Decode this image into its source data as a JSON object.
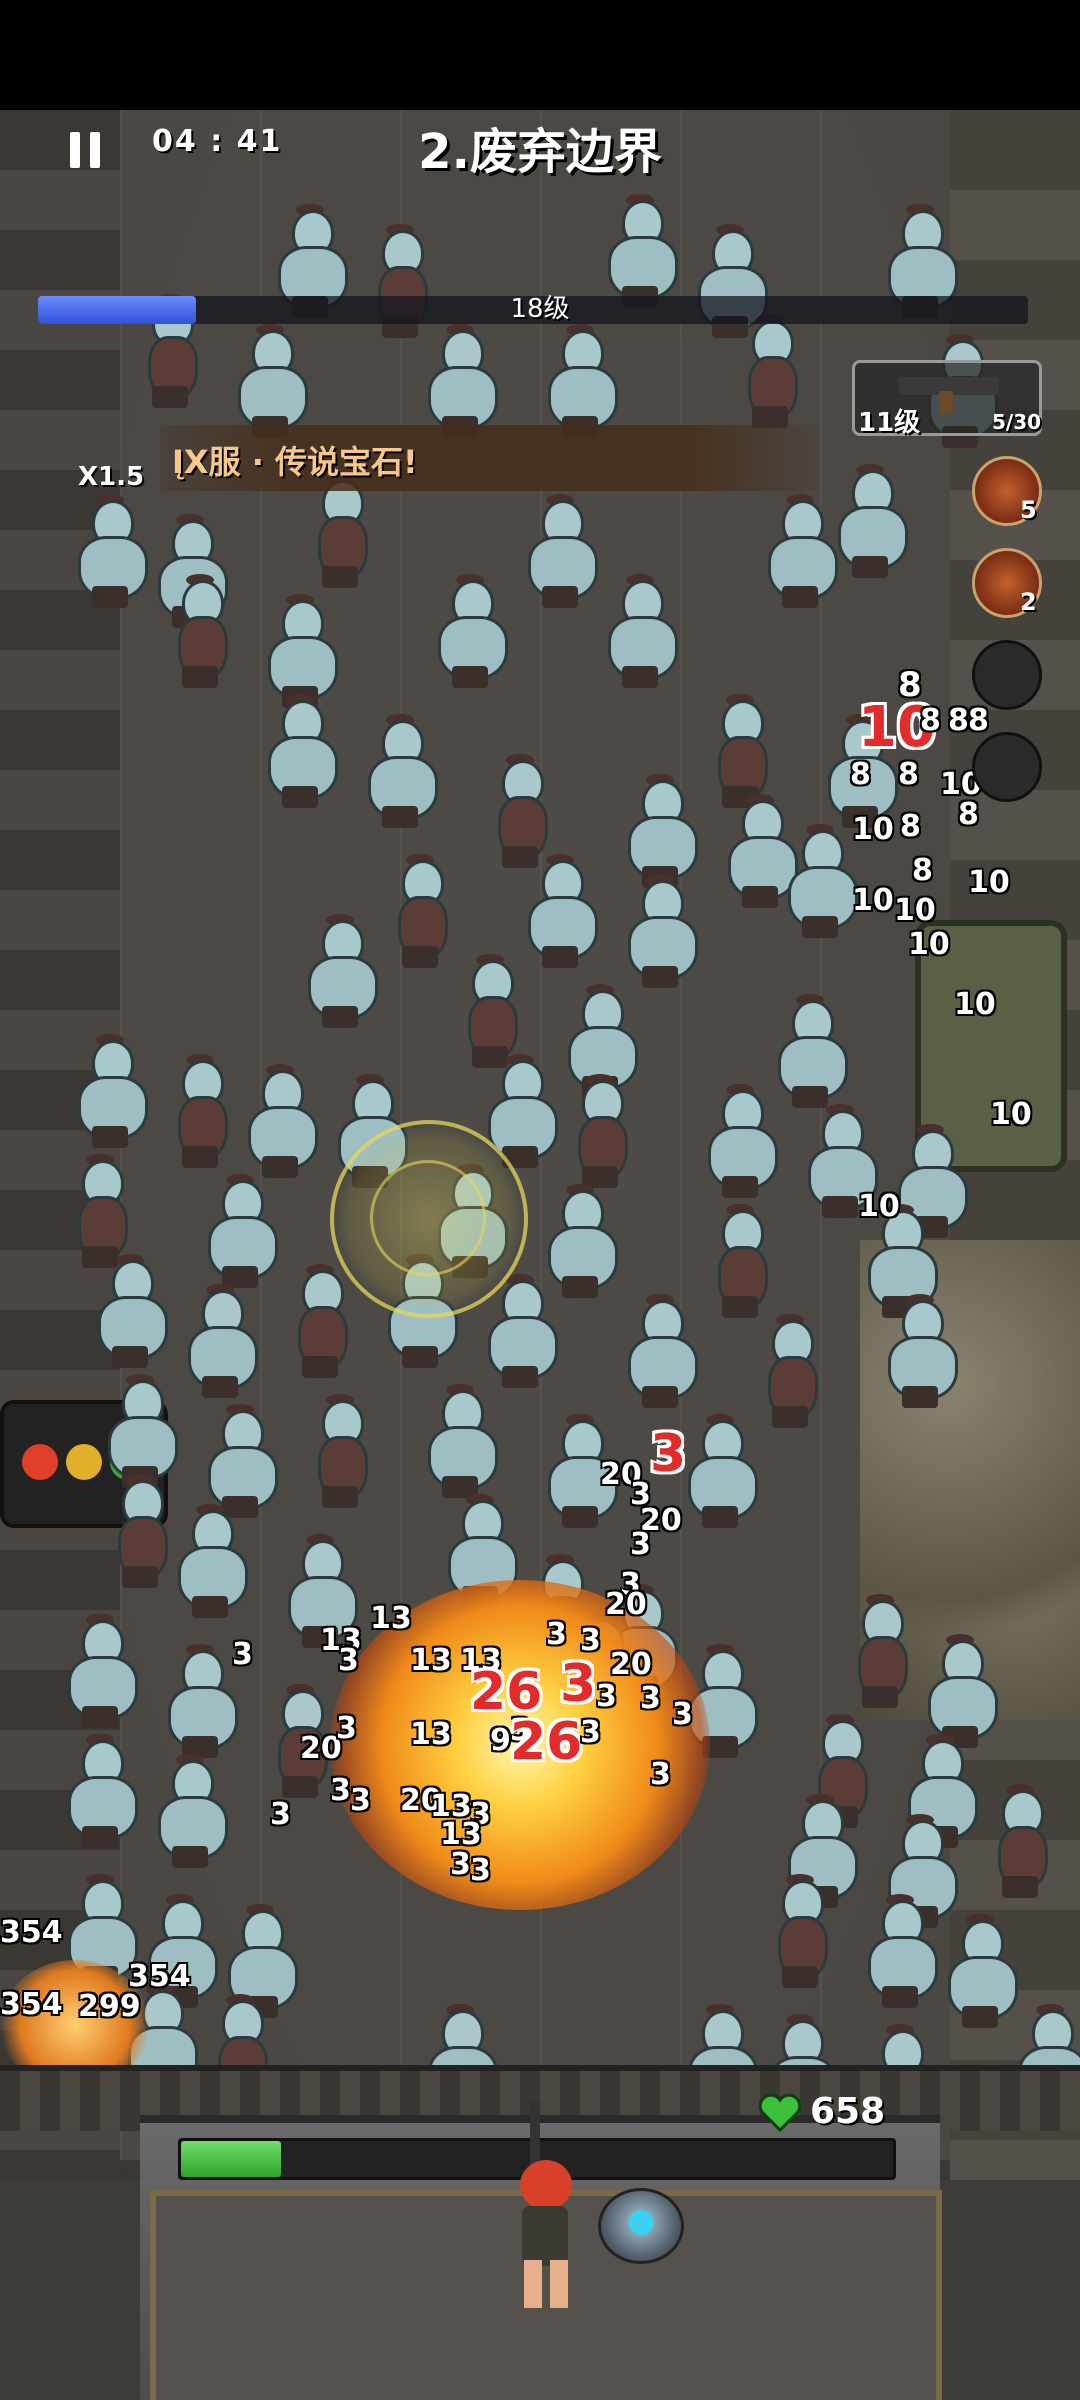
{
  "hud": {
    "timer": "04 : 41",
    "stage_title": "2.废弃边界",
    "level": "18级",
    "level_progress": 0.16,
    "banner": "ĮX服 · 传说宝石!",
    "speed": "X1.5"
  },
  "weapon": {
    "level": "11级",
    "ammo": "5/30"
  },
  "skills": [
    {
      "count": "5",
      "state": "active"
    },
    {
      "count": "2",
      "state": "active"
    },
    {
      "count": "",
      "state": "empty"
    },
    {
      "count": "",
      "state": "empty"
    }
  ],
  "base": {
    "hp": "658",
    "hp_fraction": 0.14
  },
  "damage_numbers": [
    "8",
    "10",
    "8",
    "8",
    "8",
    "8",
    "10",
    "8",
    "8",
    "10",
    "8",
    "10",
    "10",
    "8",
    "10",
    "10",
    "10",
    "10",
    "10",
    "3",
    "20",
    "3",
    "20",
    "3",
    "13",
    "3",
    "20",
    "3",
    "13",
    "3",
    "13",
    "13",
    "3",
    "26",
    "3",
    "3",
    "3",
    "20",
    "9",
    "26",
    "3",
    "3",
    "3",
    "3",
    "3",
    "20",
    "3",
    "13",
    "3",
    "3",
    "20",
    "13",
    "3",
    "3",
    "13",
    "3",
    "3",
    "354",
    "354",
    "354",
    "299",
    "354"
  ],
  "colors": {
    "progress_blue": "#3b5fe6",
    "hp_green": "#3cc23a",
    "damage_red": "#e22b2b",
    "banner_text": "#f7c88a"
  }
}
